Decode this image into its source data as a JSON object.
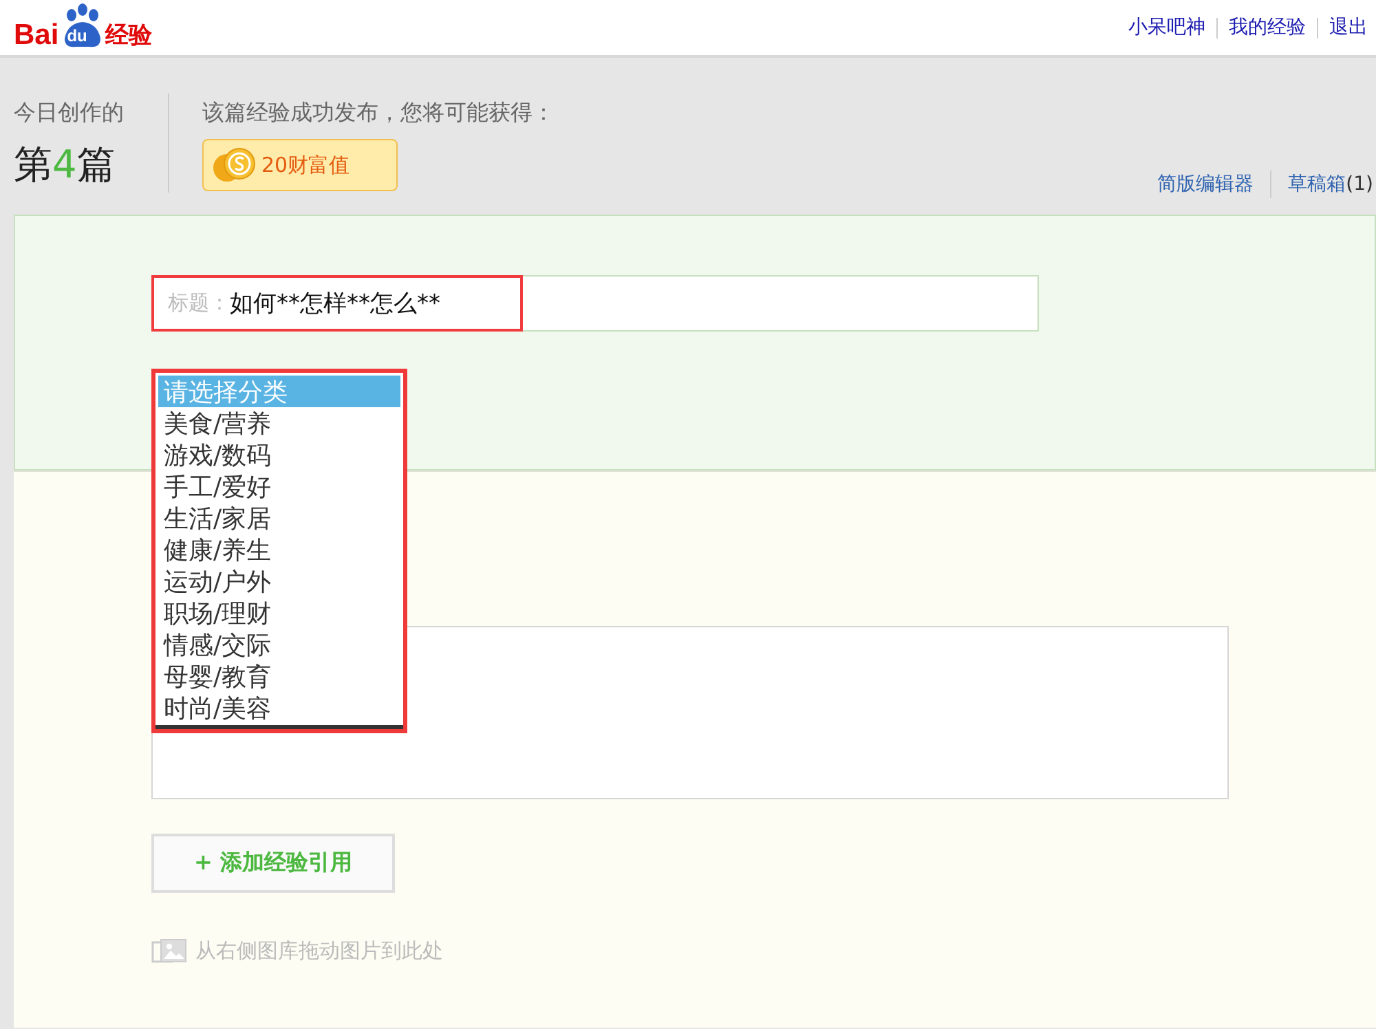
{
  "header": {
    "logo": {
      "part_1": "Bai",
      "part_2": "du",
      "part_3": "经验"
    },
    "links": [
      "小呆吧神",
      "我的经验",
      "退出"
    ]
  },
  "stats": {
    "label": "今日创作的",
    "count_prefix": "第",
    "count": "4",
    "count_suffix": "篇",
    "reward_intro": "该篇经验成功发布，您将可能获得：",
    "reward": "20财富值"
  },
  "tools": [
    {
      "label": "简版编辑器"
    },
    {
      "label": "草稿箱",
      "count": "(1)"
    }
  ],
  "title_field": {
    "label": "标题：",
    "value": "如何**怎样**怎么**"
  },
  "category_list": {
    "options": [
      {
        "label": "请选择分类",
        "selected": true
      },
      {
        "label": "美食/营养",
        "selected": false
      },
      {
        "label": "游戏/数码",
        "selected": false
      },
      {
        "label": "手工/爱好",
        "selected": false
      },
      {
        "label": "生活/家居",
        "selected": false
      },
      {
        "label": "健康/养生",
        "selected": false
      },
      {
        "label": "运动/户外",
        "selected": false
      },
      {
        "label": "职场/理财",
        "selected": false
      },
      {
        "label": "情感/交际",
        "selected": false
      },
      {
        "label": "母婴/教育",
        "selected": false
      },
      {
        "label": "时尚/美容",
        "selected": false
      }
    ]
  },
  "add_reference_button": "+ 添加经验引用",
  "image_hint": "从右侧图库拖动图片到此处"
}
